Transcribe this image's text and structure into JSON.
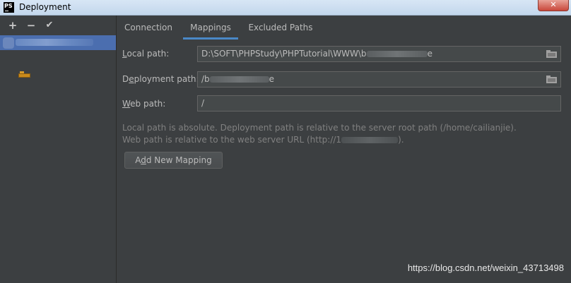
{
  "window": {
    "title": "Deployment",
    "app_icon_label": "PS",
    "close_label": "✕"
  },
  "left_toolbar": {
    "add_label": "+",
    "remove_label": "−",
    "apply_label": "✔"
  },
  "tabs": [
    {
      "label": "Connection",
      "active": false
    },
    {
      "label": "Mappings",
      "active": true
    },
    {
      "label": "Excluded Paths",
      "active": false
    }
  ],
  "mapping": {
    "local_path": {
      "label_pre": "",
      "label_u": "L",
      "label_post": "ocal path:",
      "value": "D:\\SOFT\\PHPStudy\\PHPTutorial\\WWW\\b",
      "value_tail": "e"
    },
    "deployment_path": {
      "label_pre": "D",
      "label_u": "e",
      "label_post": "ployment path:",
      "value": "/b",
      "value_tail": "e"
    },
    "web_path": {
      "label_pre": "",
      "label_u": "W",
      "label_post": "eb path:",
      "value": "/"
    }
  },
  "hint": {
    "line1": "Local path is absolute. Deployment path is relative to the server root path (/home/cailianjie).",
    "line2_pre": "Web path is relative to the web server URL (http://1",
    "line2_post": ")."
  },
  "add_button": {
    "label_pre": "A",
    "label_u": "d",
    "label_post": "d New Mapping"
  },
  "watermark": "https://blog.csdn.net/weixin_43713498",
  "colors": {
    "background": "#3c3f41",
    "selection": "#4b6eaf",
    "tab_underline": "#4a88c7",
    "field_bg": "#45494a"
  }
}
